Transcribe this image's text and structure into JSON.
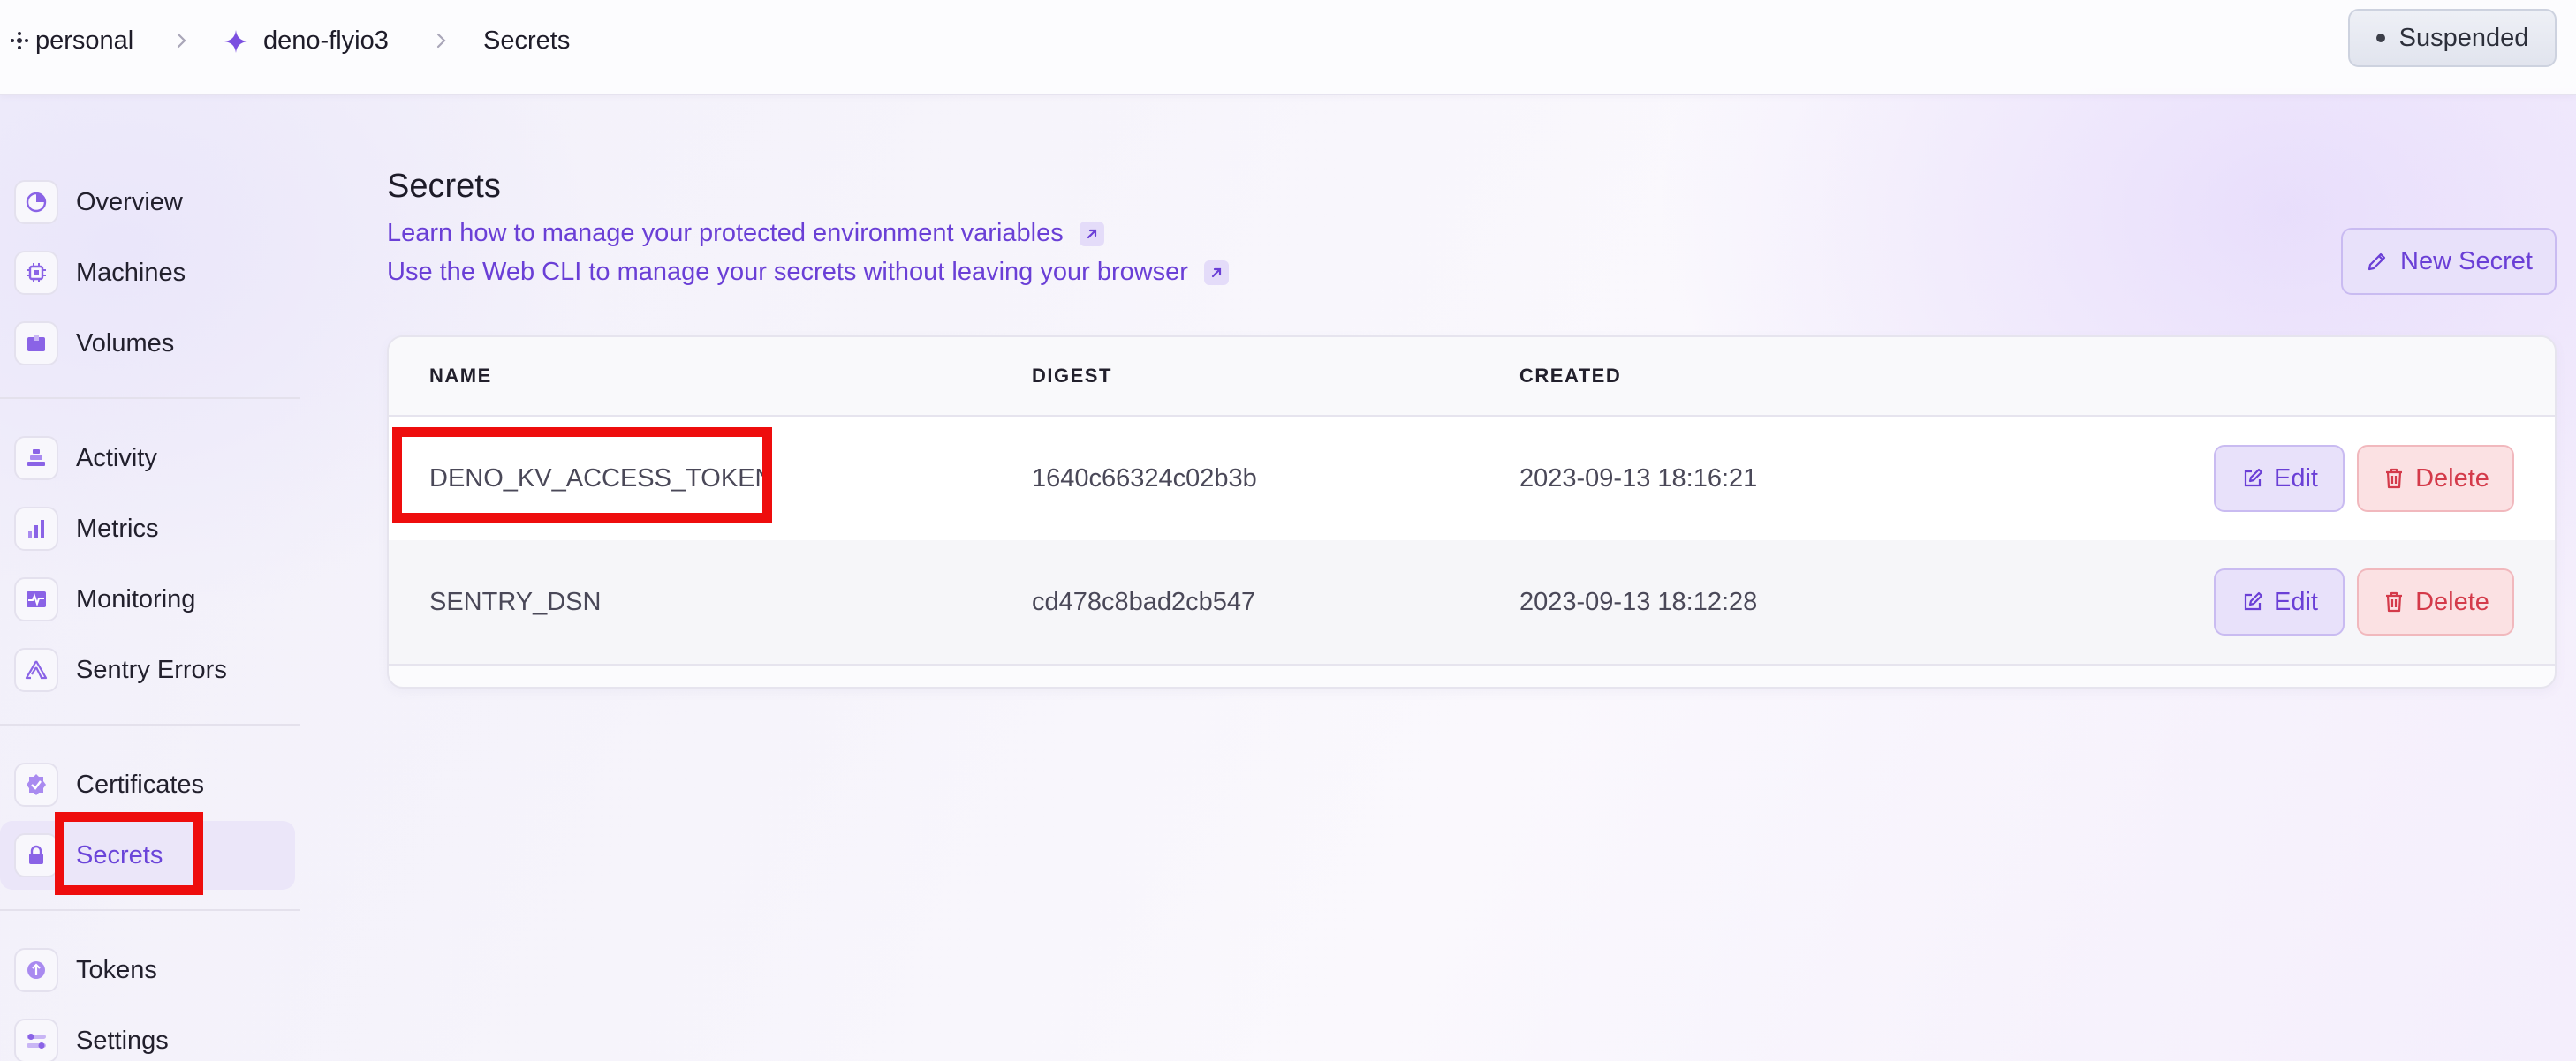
{
  "breadcrumb": {
    "org": "personal",
    "app": "deno-flyio3",
    "page": "Secrets"
  },
  "status": {
    "label": "Suspended"
  },
  "sidebar": {
    "items": [
      {
        "label": "Overview",
        "icon": "overview-icon"
      },
      {
        "label": "Machines",
        "icon": "chip-icon"
      },
      {
        "label": "Volumes",
        "icon": "box-icon"
      },
      {
        "label": "Activity",
        "icon": "activity-icon"
      },
      {
        "label": "Metrics",
        "icon": "bar-chart-icon"
      },
      {
        "label": "Monitoring",
        "icon": "pulse-icon"
      },
      {
        "label": "Sentry Errors",
        "icon": "sentry-icon"
      },
      {
        "label": "Certificates",
        "icon": "badge-check-icon"
      },
      {
        "label": "Secrets",
        "icon": "lock-icon",
        "active": true
      },
      {
        "label": "Tokens",
        "icon": "token-icon"
      },
      {
        "label": "Settings",
        "icon": "settings-icon"
      }
    ]
  },
  "main": {
    "title": "Secrets",
    "help_links": [
      "Learn how to manage your protected environment variables",
      "Use the Web CLI to manage your secrets without leaving your browser"
    ],
    "new_secret_label": "New Secret"
  },
  "table": {
    "columns": [
      "NAME",
      "DIGEST",
      "CREATED"
    ],
    "rows": [
      {
        "name": "DENO_KV_ACCESS_TOKEN",
        "digest": "1640c66324c02b3b",
        "created": "2023-09-13 18:16:21"
      },
      {
        "name": "SENTRY_DSN",
        "digest": "cd478c8bad2cb547",
        "created": "2023-09-13 18:12:28"
      }
    ],
    "edit_label": "Edit",
    "delete_label": "Delete"
  },
  "colors": {
    "accent": "#6a3fd6",
    "danger": "#d43a4a",
    "highlight": "#ee0d0d"
  }
}
